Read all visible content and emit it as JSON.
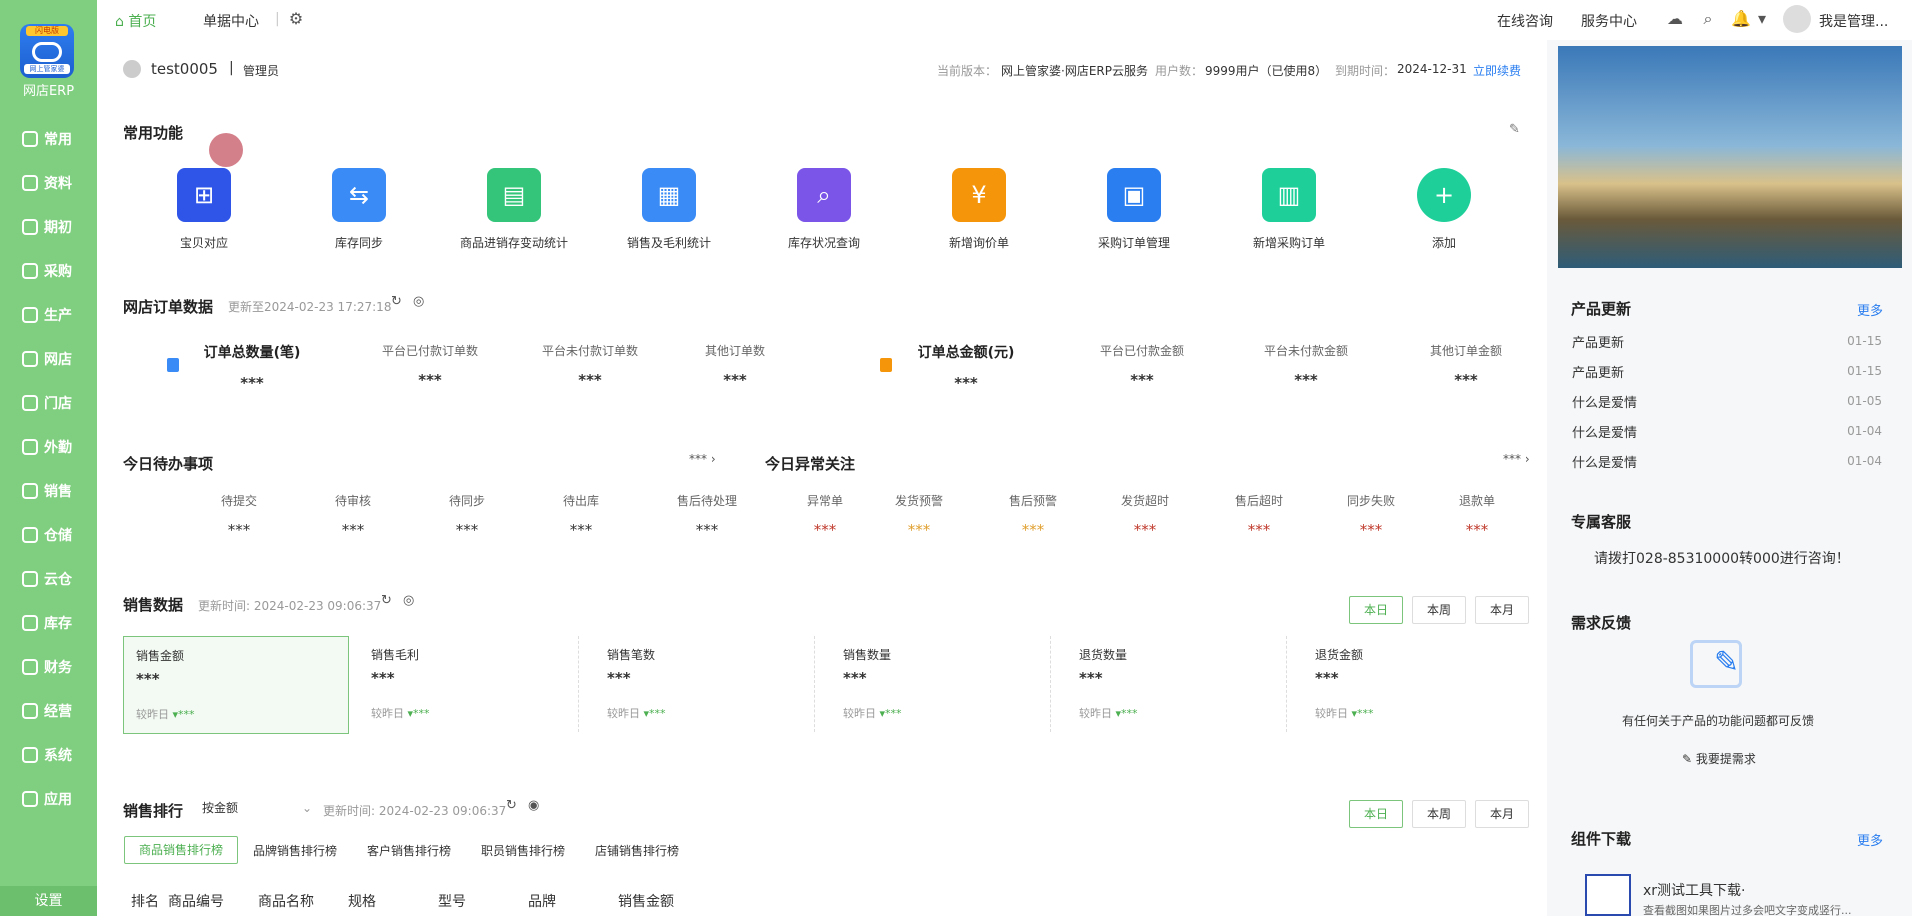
{
  "sidebar": {
    "logo_badge": "闪电版",
    "logo_sub": "网上管家婆",
    "brand": "网店ERP",
    "items": [
      "常用",
      "资料",
      "期初",
      "采购",
      "生产",
      "网店",
      "门店",
      "外勤",
      "销售",
      "仓储",
      "云仓",
      "库存",
      "财务",
      "经营",
      "系统",
      "应用"
    ],
    "settings": "设置"
  },
  "topbar": {
    "tab_home": "首页",
    "tab_docs": "单据中心",
    "online": "在线咨询",
    "service": "服务中心",
    "user": "我是管理..."
  },
  "account": {
    "user": "test0005",
    "role": "管理员",
    "version_label": "当前版本：",
    "version": "网上管家婆·网店ERP云服务",
    "users_label": "用户数：",
    "users": "9999用户（已使用8）",
    "expire_label": "到期时间：",
    "expire": "2024-12-31",
    "renew": "立即续费"
  },
  "common": {
    "title": "常用功能",
    "items": [
      {
        "label": "宝贝对应",
        "color": "#2f55e8",
        "icon": "⊞"
      },
      {
        "label": "库存同步",
        "color": "#3a8bf5",
        "icon": "⇆"
      },
      {
        "label": "商品进销存变动统计",
        "color": "#34c47a",
        "icon": "▤"
      },
      {
        "label": "销售及毛利统计",
        "color": "#3a8bf5",
        "icon": "▦"
      },
      {
        "label": "库存状况查询",
        "color": "#7a55e8",
        "icon": "⌕"
      },
      {
        "label": "新增询价单",
        "color": "#f5950a",
        "icon": "¥"
      },
      {
        "label": "采购订单管理",
        "color": "#2a7ef0",
        "icon": "▣"
      },
      {
        "label": "新增采购订单",
        "color": "#1fcf9a",
        "icon": "▥"
      },
      {
        "label": "添加",
        "color": "#1fcf9a",
        "icon": "+"
      }
    ]
  },
  "orders": {
    "title": "网店订单数据",
    "updated": "更新至2024-02-23 17:27:18",
    "left": [
      {
        "label": "订单总数量(笔)",
        "value": "***"
      },
      {
        "label": "平台已付款订单数",
        "value": "***"
      },
      {
        "label": "平台未付款订单数",
        "value": "***"
      },
      {
        "label": "其他订单数",
        "value": "***"
      }
    ],
    "right": [
      {
        "label": "订单总金额(元)",
        "value": "***"
      },
      {
        "label": "平台已付款金额",
        "value": "***"
      },
      {
        "label": "平台未付款金额",
        "value": "***"
      },
      {
        "label": "其他订单金额",
        "value": "***"
      }
    ]
  },
  "todo": {
    "title": "今日待办事项",
    "more": "***",
    "items": [
      {
        "label": "待提交",
        "value": "***"
      },
      {
        "label": "待审核",
        "value": "***"
      },
      {
        "label": "待同步",
        "value": "***"
      },
      {
        "label": "待出库",
        "value": "***"
      },
      {
        "label": "售后待处理",
        "value": "***"
      }
    ]
  },
  "abnormal": {
    "title": "今日异常关注",
    "more": "***",
    "items": [
      {
        "label": "异常单",
        "value": "***",
        "color": "#c0392b"
      },
      {
        "label": "发货预警",
        "value": "***",
        "color": "#e0a030"
      },
      {
        "label": "售后预警",
        "value": "***",
        "color": "#e0a030"
      },
      {
        "label": "发货超时",
        "value": "***",
        "color": "#c0392b"
      },
      {
        "label": "售后超时",
        "value": "***",
        "color": "#c0392b"
      },
      {
        "label": "同步失败",
        "value": "***",
        "color": "#c0392b"
      },
      {
        "label": "退款单",
        "value": "***",
        "color": "#c0392b"
      }
    ]
  },
  "sales": {
    "title": "销售数据",
    "updated": "更新时间: 2024-02-23 09:06:37",
    "btn_day": "本日",
    "btn_week": "本周",
    "btn_month": "本月",
    "compare": "较昨日",
    "cards": [
      {
        "label": "销售金额",
        "value": "***",
        "delta": "***"
      },
      {
        "label": "销售毛利",
        "value": "***",
        "delta": "***"
      },
      {
        "label": "销售笔数",
        "value": "***",
        "delta": "***"
      },
      {
        "label": "销售数量",
        "value": "***",
        "delta": "***"
      },
      {
        "label": "退货数量",
        "value": "***",
        "delta": "***"
      },
      {
        "label": "退货金额",
        "value": "***",
        "delta": "***"
      }
    ]
  },
  "ranking": {
    "title": "销售排行",
    "select": "按金额",
    "updated": "更新时间: 2024-02-23 09:06:37",
    "tabs": [
      "商品销售排行榜",
      "品牌销售排行榜",
      "客户销售排行榜",
      "职员销售排行榜",
      "店铺销售排行榜"
    ],
    "columns": [
      "排名",
      "商品编号",
      "商品名称",
      "规格",
      "型号",
      "品牌",
      "销售金额"
    ]
  },
  "right": {
    "updates_title": "产品更新",
    "more": "更多",
    "updates": [
      {
        "title": "产品更新",
        "date": "01-15"
      },
      {
        "title": "产品更新",
        "date": "01-15"
      },
      {
        "title": "什么是爱情",
        "date": "01-05"
      },
      {
        "title": "什么是爱情",
        "date": "01-04"
      },
      {
        "title": "什么是爱情",
        "date": "01-04"
      }
    ],
    "service_title": "专属客服",
    "service_text": "请拨打028-85310000转000进行咨询！",
    "feedback_title": "需求反馈",
    "feedback_text": "有任何关于产品的功能问题都可反馈",
    "feedback_btn": "我要提需求",
    "download_title": "组件下载",
    "download_item": "xr测试工具下载·",
    "download_desc": "查看截图如果图片过多会吧文字变成竖行..."
  }
}
